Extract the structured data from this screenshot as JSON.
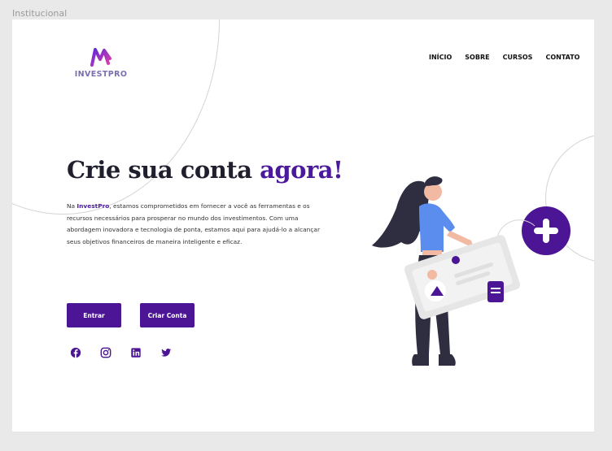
{
  "frame_label": "Institucional",
  "brand": {
    "name": "INVESTPRO"
  },
  "nav": {
    "items": [
      {
        "label": "INÍCIO"
      },
      {
        "label": "SOBRE"
      },
      {
        "label": "CURSOS"
      },
      {
        "label": "CONTATO"
      }
    ]
  },
  "hero": {
    "title_main": "Crie sua conta ",
    "title_accent": "agora!",
    "desc_before": "Na ",
    "desc_brand": "InvestPro",
    "desc_after": ", estamos comprometidos em fornecer a você as ferramentas e  os recursos necessários para prosperar no mundo dos investimentos. Com  uma abordagem inovadora e tecnologia de ponta, estamos aqui para  ajudá-lo a alcançar seus objetivos financeiros de maneira inteligente e  eficaz."
  },
  "buttons": {
    "login": "Entrar",
    "signup": "Criar Conta"
  },
  "social": [
    "facebook-icon",
    "instagram-icon",
    "linkedin-icon",
    "twitter-icon"
  ],
  "colors": {
    "primary": "#4b1596",
    "accent_text": "#4b1a9c",
    "illustration_blue": "#5b8def",
    "illustration_purple": "#4b1596"
  }
}
